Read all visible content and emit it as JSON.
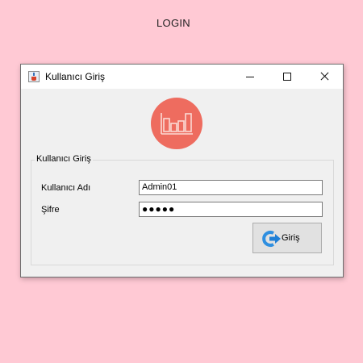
{
  "page": {
    "heading": "LOGIN"
  },
  "window": {
    "title": "Kullanıcı Giriş",
    "controls": {
      "minimize": "minimize-icon",
      "maximize": "maximize-icon",
      "close": "close-icon"
    }
  },
  "logo": {
    "icon": "bar-chart-icon",
    "color": "#ee6c5f"
  },
  "form": {
    "group_title": "Kullanıcı Giriş",
    "username_label": "Kullanıcı Adı",
    "username_value": "Admin01",
    "password_label": "Şifre",
    "password_value": "●●●●●",
    "login_button": "Giriş",
    "login_icon": "login-arrow-icon"
  },
  "colors": {
    "background": "#ffc9d4",
    "window": "#f0f0f0",
    "accent": "#ee6c5f",
    "button_icon": "#2f8fe0"
  }
}
